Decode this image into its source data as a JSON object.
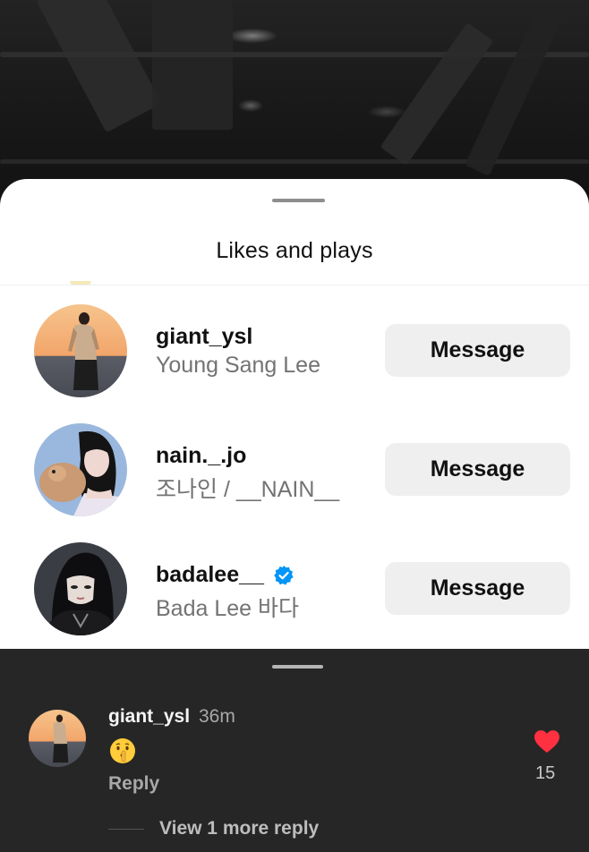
{
  "sheet": {
    "title": "Likes and plays"
  },
  "likers": [
    {
      "username": "giant_ysl",
      "full_name": "Young Sang Lee",
      "verified": false,
      "button_label": "Message"
    },
    {
      "username": "nain._.jo",
      "full_name": "조나인 / __NAIN__",
      "verified": false,
      "button_label": "Message"
    },
    {
      "username": "badalee__",
      "full_name": "Bada Lee 바다",
      "verified": true,
      "button_label": "Message"
    }
  ],
  "comment": {
    "username": "giant_ysl",
    "time": "36m",
    "emoji": "shushing-face",
    "reply_label": "Reply",
    "like_count": "15",
    "view_more_label": "View 1 more reply"
  },
  "colors": {
    "verified": "#0095f6",
    "heart": "#ff3040",
    "comments_bg": "#262626"
  }
}
